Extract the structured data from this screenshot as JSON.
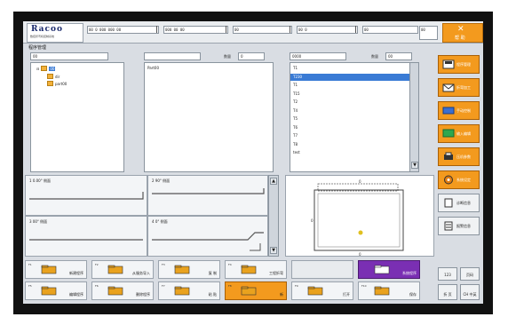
{
  "header": {
    "brand": "Racoo",
    "brand_sub": "数控折弯机控制系统",
    "status_fields": [
      "00 0 000 000 00",
      "000 00 00",
      "00",
      "00 0",
      "00",
      "00"
    ],
    "help_label": "帮 助"
  },
  "page_title": "程序管理",
  "dir_panel": {
    "path_value": "00",
    "tree": [
      {
        "label": "00",
        "selected": true
      },
      {
        "label": "dir",
        "selected": false
      },
      {
        "label": "part00",
        "selected": false
      }
    ]
  },
  "program_panel": {
    "path_value": "",
    "count_label": "数量",
    "count_value": "0",
    "items": [
      "Part00"
    ]
  },
  "tool_panel": {
    "path_value": "0000",
    "count_label": "数量",
    "count_value": "00",
    "items": [
      "T1",
      "T230",
      "T1",
      "T15",
      "T2",
      "T4",
      "T5",
      "T6",
      "T7",
      "T8",
      "test"
    ],
    "selected_index": 1
  },
  "right_buttons": [
    {
      "label": "程序管理",
      "icon": "save-disk-icon",
      "style": "orange"
    },
    {
      "label": "折弯加工",
      "icon": "envelope-icon",
      "style": "orange"
    },
    {
      "label": "手动控制",
      "icon": "keyboard-icon",
      "style": "orange"
    },
    {
      "label": "输入编辑",
      "icon": "monitor-icon",
      "style": "orange"
    },
    {
      "label": "压机参数",
      "icon": "printer-icon",
      "style": "orange"
    },
    {
      "label": "系统设定",
      "icon": "gear-icon",
      "style": "orange"
    },
    {
      "label": "诊断信息",
      "icon": "document-icon",
      "style": "gray"
    },
    {
      "label": "报警信息",
      "icon": "list-icon",
      "style": "gray"
    }
  ],
  "bends": [
    {
      "label": "1 0.00° 侧面"
    },
    {
      "label": "2 90° 侧面"
    },
    {
      "label": "3 00° 侧面"
    },
    {
      "label": "4 0° 侧面"
    }
  ],
  "preview": {
    "dim_top": "0",
    "dim_bottom": "0",
    "dim_left": "0"
  },
  "toolbar": [
    {
      "key": "F1",
      "label": "新建程序",
      "icon": "new-folder-icon",
      "style": "normal"
    },
    {
      "key": "F2",
      "label": "从服务导入",
      "icon": "import-icon",
      "style": "normal"
    },
    {
      "key": "F3",
      "label": "复 制",
      "icon": "copy-icon",
      "style": "normal"
    },
    {
      "key": "F4",
      "label": "工程折弯",
      "icon": "settings-icon",
      "style": "normal"
    },
    {
      "key": "",
      "label": "",
      "icon": "",
      "style": "blank"
    },
    {
      "key": "",
      "label": "系统程序",
      "icon": "info-icon",
      "style": "purple"
    },
    {
      "key": "F5",
      "label": "编辑程序",
      "icon": "edit-icon",
      "style": "normal"
    },
    {
      "key": "F6",
      "label": "删除程序",
      "icon": "delete-icon",
      "style": "normal"
    },
    {
      "key": "F7",
      "label": "粘 贴",
      "icon": "paste-icon",
      "style": "normal"
    },
    {
      "key": "F8",
      "label": "新",
      "icon": "folder-icon",
      "style": "active"
    },
    {
      "key": "F9",
      "label": "打开",
      "icon": "folder-open-icon",
      "style": "normal"
    },
    {
      "key": "F10",
      "label": "保存",
      "icon": "folder-save-icon",
      "style": "normal"
    }
  ],
  "small_buttons": [
    {
      "label": "123",
      "name": "numeric-keypad-button"
    },
    {
      "label": "页码",
      "name": "page-button"
    },
    {
      "label": "折 页",
      "name": "fold-button"
    },
    {
      "label": "CH 中英",
      "name": "language-button"
    }
  ]
}
